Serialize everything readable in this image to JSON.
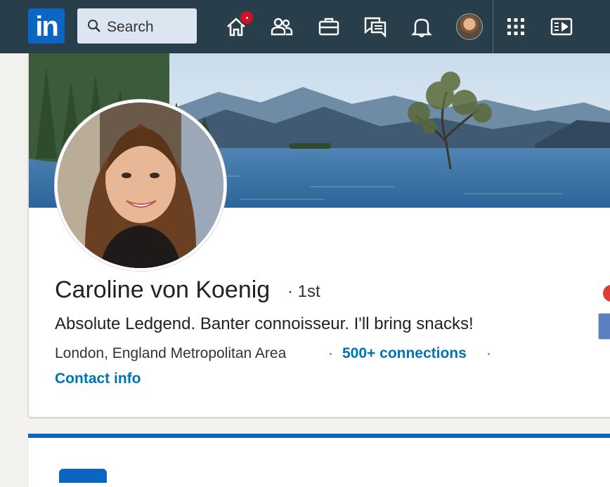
{
  "nav": {
    "logo_text": "in",
    "search_placeholder": "Search",
    "icons": [
      "home-icon",
      "my-network-icon",
      "jobs-icon",
      "messaging-icon",
      "notifications-icon",
      "me-avatar",
      "work-grid-icon",
      "learning-icon"
    ]
  },
  "profile": {
    "name": "Caroline von Koenig",
    "degree": "· 1st",
    "headline": "Absolute Ledgend. Banter connoisseur. I'll bring snacks!",
    "location": "London, England Metropolitan Area",
    "separator": "·",
    "connections": "500+ connections",
    "contact_info": "Contact info"
  },
  "colors": {
    "nav_bg": "#283e4a",
    "brand": "#0a66c2",
    "link": "#0073b1",
    "badge": "#d11124"
  }
}
